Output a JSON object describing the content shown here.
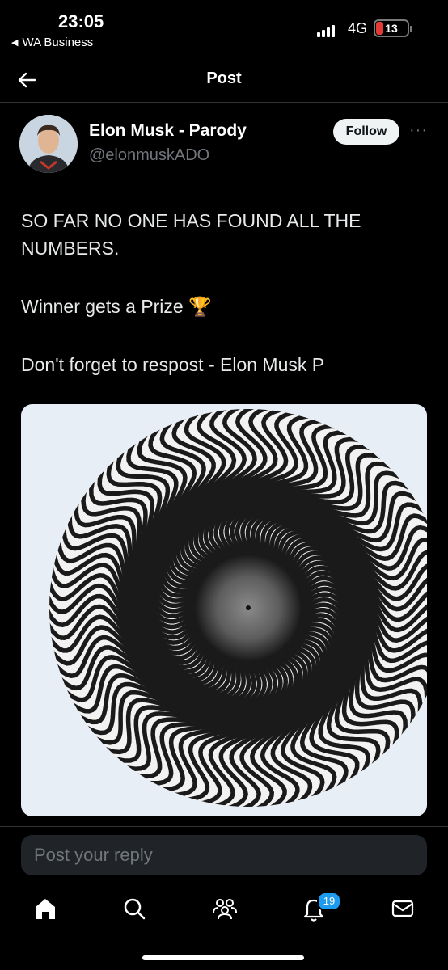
{
  "status_bar": {
    "time": "23:05",
    "back_app": "WA Business",
    "network": "4G",
    "battery_level": "13",
    "battery_fraction": 0.13
  },
  "header": {
    "title": "Post",
    "back_icon": "arrow-left-icon"
  },
  "author": {
    "name": "Elon Musk - Parody",
    "handle": "@elonmuskADO",
    "follow_label": "Follow",
    "more_icon": "more-dots-icon"
  },
  "post": {
    "line1": "SO FAR NO ONE HAS FOUND ALL THE NUMBERS.",
    "line2": "Winner gets a Prize 🏆",
    "line3": "Don't forget to respost - Elon Musk P",
    "media_icon": "optical-illusion-image"
  },
  "reply": {
    "placeholder": "Post your reply"
  },
  "tabbar": {
    "items": [
      "home-icon",
      "search-icon",
      "communities-icon",
      "notifications-icon",
      "messages-icon"
    ],
    "notifications_badge": "19"
  },
  "colors": {
    "accent": "#1d9bf0",
    "background": "#000000",
    "muted": "#71767b"
  }
}
